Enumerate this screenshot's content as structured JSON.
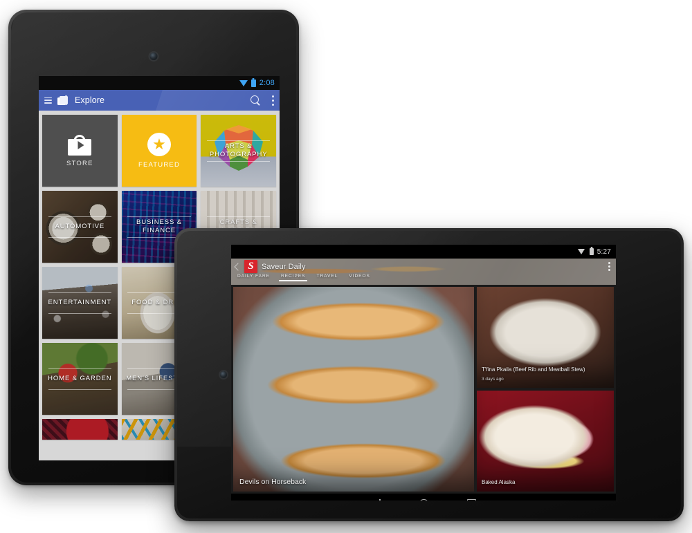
{
  "scene": {
    "description": "Two Nexus 7 Android tablets displaying Google Play Newsstand",
    "background_color": "#ffffff"
  },
  "device1": {
    "name": "nexus-7-back",
    "status_bar": {
      "time": "2:08",
      "wifi_icon": "wifi-icon",
      "battery_icon": "battery-icon"
    },
    "action_bar": {
      "menu_icon": "hamburger-menu-icon",
      "app_icon": "newsstand-icon",
      "title": "Explore",
      "search_icon": "search-icon",
      "overflow_icon": "overflow-menu-icon",
      "accent_color": "#4861b5"
    },
    "tiles": [
      {
        "label": "STORE",
        "type": "store",
        "icon": "play-store-bag-icon",
        "color": "#4f4f4f"
      },
      {
        "label": "FEATURED",
        "type": "featured",
        "icon": "star-icon",
        "color": "#f6bc13"
      },
      {
        "label": "ARTS & PHOTOGRAPHY",
        "type": "photo",
        "bg": "arts"
      },
      {
        "label": "AUTOMOTIVE",
        "type": "photo",
        "bg": "auto"
      },
      {
        "label": "BUSINESS & FINANCE",
        "type": "photo",
        "bg": "biz"
      },
      {
        "label": "CRAFTS & HOBBIES",
        "type": "photo",
        "bg": "crafts"
      },
      {
        "label": "ENTERTAINMENT",
        "type": "photo",
        "bg": "ent"
      },
      {
        "label": "FOOD & DRINK",
        "type": "photo",
        "bg": "food"
      },
      {
        "label": "",
        "type": "photo",
        "bg": "part3"
      },
      {
        "label": "HOME & GARDEN",
        "type": "photo",
        "bg": "home"
      },
      {
        "label": "MEN'S LIFESTYLE",
        "type": "photo",
        "bg": "mens"
      },
      {
        "label": "",
        "type": "photo",
        "bg": "part3"
      }
    ],
    "partial_tiles": [
      {
        "bg": "part1"
      },
      {
        "bg": "part2"
      },
      {
        "bg": "part3"
      }
    ],
    "nav_bar": {
      "back": "back-icon",
      "home": "home-icon",
      "recents": "recents-icon"
    }
  },
  "device2": {
    "name": "nexus-7-front",
    "status_bar": {
      "time": "5:27",
      "wifi_icon": "wifi-icon",
      "battery_icon": "battery-icon"
    },
    "app_bar": {
      "back_icon": "back-arrow-icon",
      "logo_letter": "S",
      "logo_color": "#d8252c",
      "title": "Saveur Daily",
      "overflow_icon": "overflow-menu-icon"
    },
    "tabs": [
      {
        "label": "DAILY FARE",
        "active": false
      },
      {
        "label": "RECIPES",
        "active": true
      },
      {
        "label": "TRAVEL",
        "active": false
      },
      {
        "label": "VIDEOS",
        "active": false
      }
    ],
    "main_article": {
      "caption": "Devils on Horseback"
    },
    "side_articles": [
      {
        "caption": "T'fina Pkaila (Beef Rib and Meatball Stew)",
        "timestamp": "3 days ago"
      },
      {
        "caption": "Baked Alaska",
        "timestamp": ""
      }
    ],
    "nav_bar": {
      "back": "back-icon",
      "home": "home-icon",
      "recents": "recents-icon"
    }
  }
}
